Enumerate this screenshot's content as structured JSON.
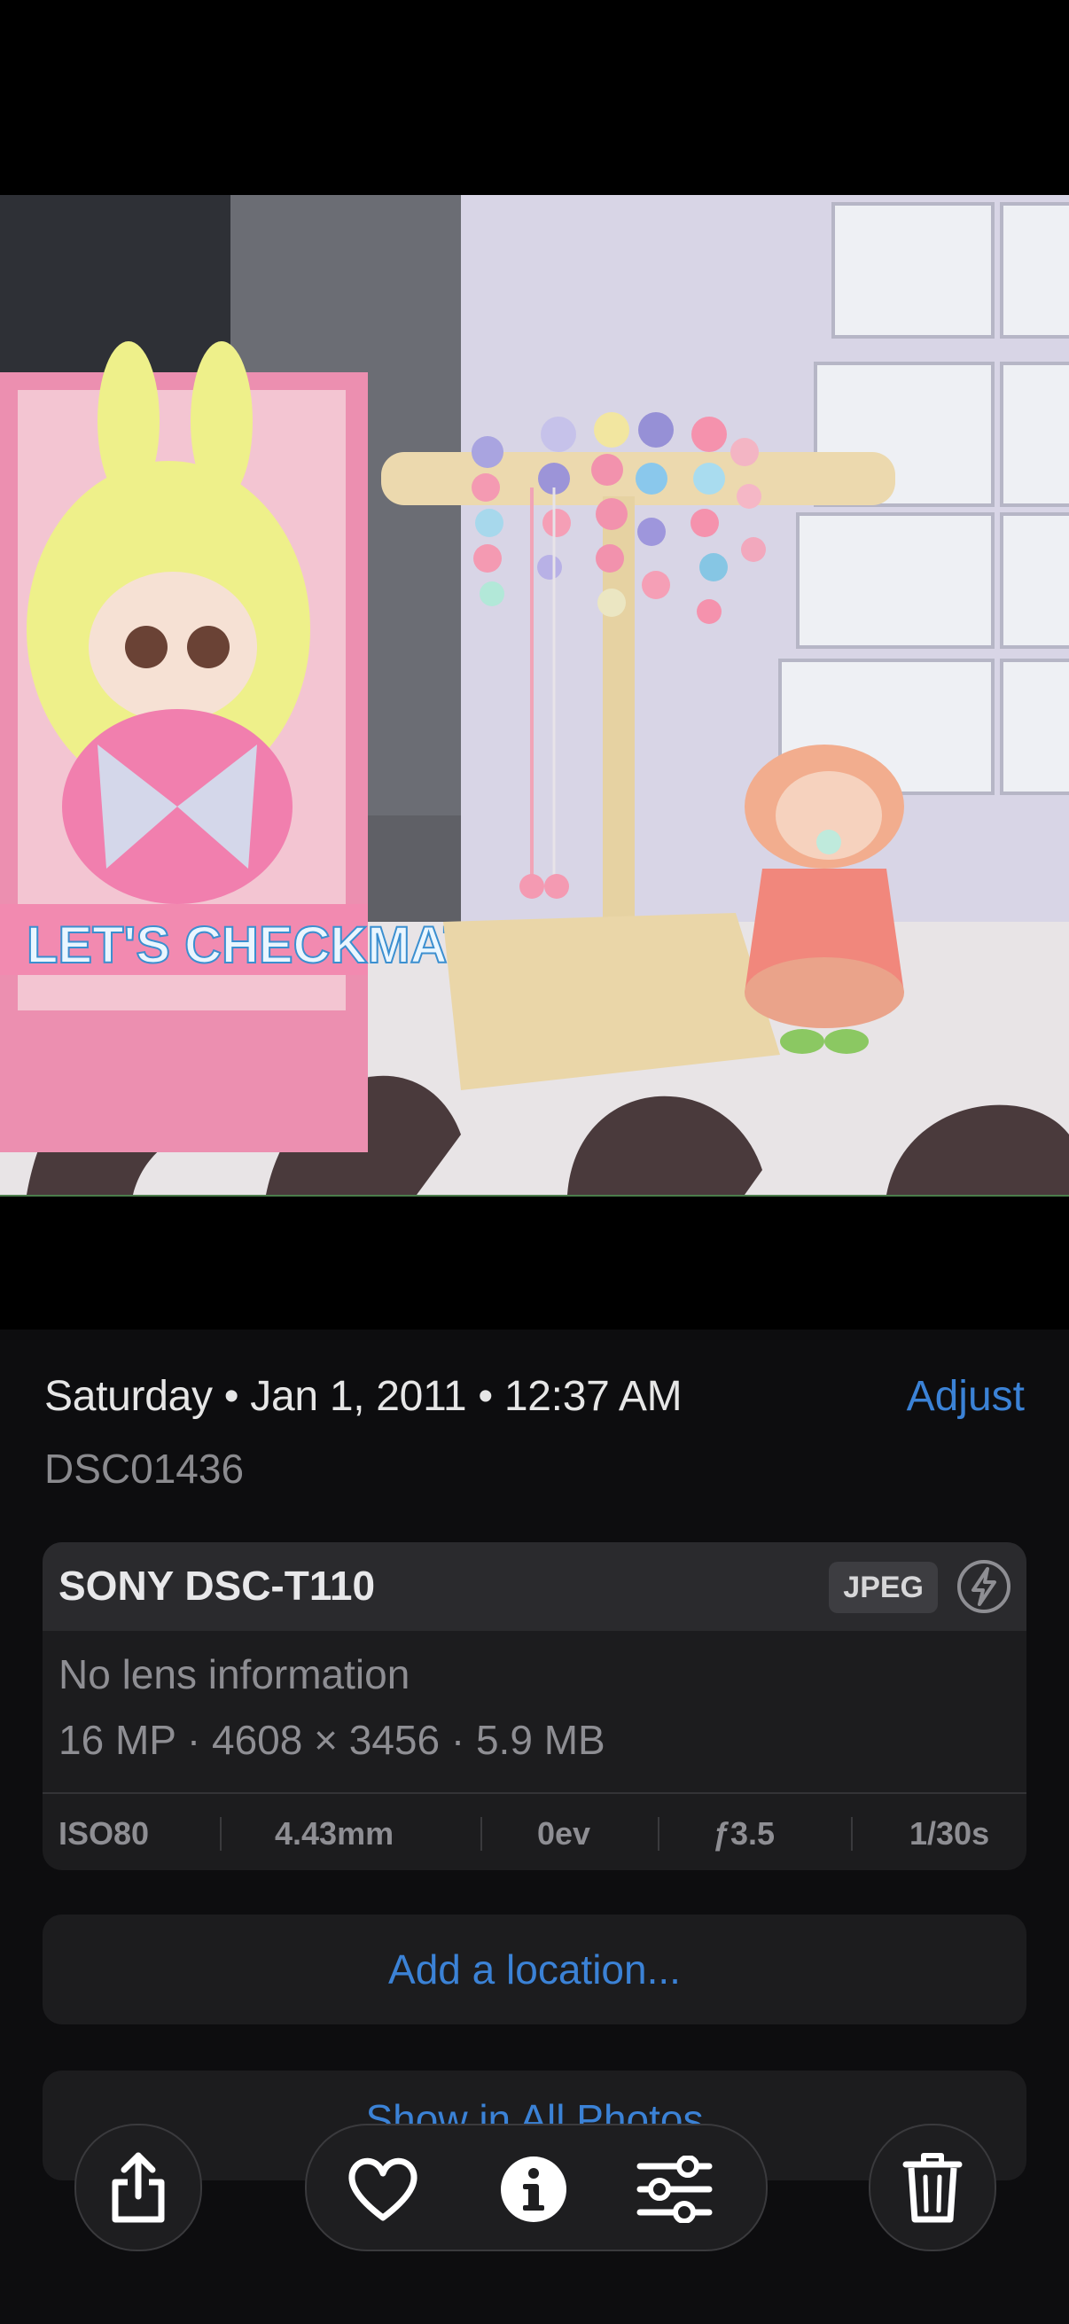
{
  "info": {
    "date_line": "Saturday • Jan 1, 2011 • 12:37 AM",
    "adjust_label": "Adjust",
    "filename": "DSC01436"
  },
  "exif": {
    "camera": "SONY DSC-T110",
    "format": "JPEG",
    "lens": "No lens information",
    "specs": "16 MP · 4608 × 3456 · 5.9 MB",
    "iso": "ISO80",
    "focal_length": "4.43mm",
    "exposure_bias": "0ev",
    "aperture": "ƒ3.5",
    "shutter": "1/30s"
  },
  "actions": {
    "add_location": "Add a location...",
    "show_all_photos": "Show in All Photos"
  },
  "photo": {
    "box_text": "LET'S CHECKMATE"
  },
  "toolbar": {
    "icons": [
      "share-icon",
      "heart-icon",
      "info-icon",
      "adjustments-icon",
      "trash-icon"
    ]
  },
  "colors": {
    "accent": "#3b82d6",
    "background": "#0d0d0f",
    "card": "#1c1c1e"
  }
}
